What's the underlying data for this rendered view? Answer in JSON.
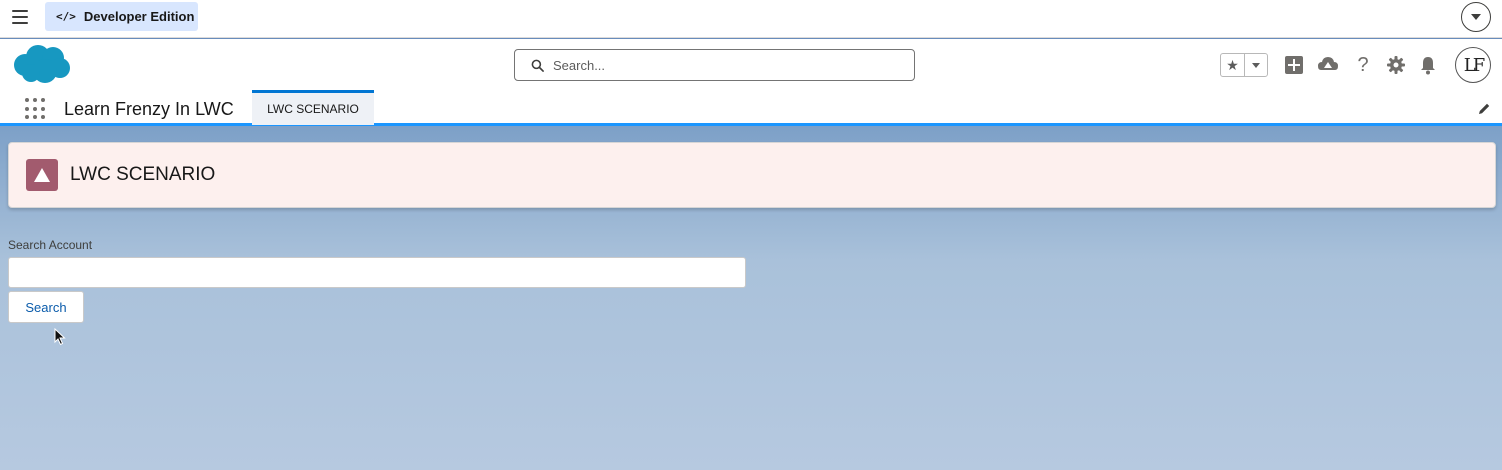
{
  "devbar": {
    "edition_label": "Developer Edition",
    "menu_icon": "hamburger-icon",
    "code_icon": "code-icon",
    "right_icon": "chevron-down-circle-icon"
  },
  "header": {
    "logo": "salesforce-cloud-logo",
    "search_placeholder": "Search...",
    "icons": [
      "favorites-star-icon",
      "favorites-caret-icon",
      "add-icon",
      "trailhead-icon",
      "help-icon",
      "setup-gear-icon",
      "notifications-bell-icon"
    ],
    "avatar_initials": "LF"
  },
  "nav": {
    "app_name": "Learn Frenzy In LWC",
    "tabs": [
      {
        "label": "LWC SCENARIO",
        "active": true
      }
    ]
  },
  "page_header": {
    "title": "LWC SCENARIO",
    "icon": "lightning-page-icon",
    "icon_color": "#a25b6e"
  },
  "form": {
    "label": "Search Account",
    "input_value": "",
    "button_label": "Search"
  },
  "colors": {
    "brand_blue": "#0176d3",
    "dev_pill": "#d8e6fe",
    "page_header_bg": "#fdf0ee"
  }
}
